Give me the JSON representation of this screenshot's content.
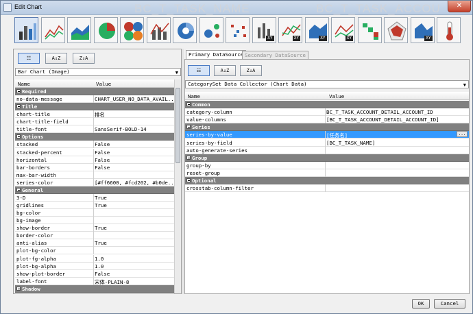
{
  "window": {
    "title": "Edit Chart",
    "close_label": "✕"
  },
  "background_titles": [
    "BC_T_TASK_NAME",
    "BC_T_TASK_ACCOU"
  ],
  "toolbar": {
    "buttons": [
      {
        "name": "bar-chart",
        "xy": ""
      },
      {
        "name": "line-chart",
        "xy": ""
      },
      {
        "name": "area-chart",
        "xy": ""
      },
      {
        "name": "pie-chart",
        "xy": ""
      },
      {
        "name": "multi-pie-chart",
        "xy": ""
      },
      {
        "name": "bar-line-chart",
        "xy": ""
      },
      {
        "name": "ring-chart",
        "xy": ""
      },
      {
        "name": "bubble-chart",
        "xy": ""
      },
      {
        "name": "scatter-chart",
        "xy": ""
      },
      {
        "name": "xy-bar-chart",
        "xy": "XY"
      },
      {
        "name": "xy-line-chart",
        "xy": "XY"
      },
      {
        "name": "xy-area-chart",
        "xy": "XY"
      },
      {
        "name": "xy-line-chart-2",
        "xy": "XY"
      },
      {
        "name": "waterfall-chart",
        "xy": ""
      },
      {
        "name": "radar-chart",
        "xy": ""
      },
      {
        "name": "xy-area-chart-2",
        "xy": "XY"
      },
      {
        "name": "thermometer-chart",
        "xy": ""
      }
    ]
  },
  "left": {
    "sort_buttons": [
      "☷",
      "A↓Z",
      "Z↓A"
    ],
    "combo": "Bar Chart (Image)",
    "col_name": "Name",
    "col_value": "Value",
    "rows": [
      {
        "type": "cat",
        "k": "Required",
        "v": ""
      },
      {
        "type": "row",
        "k": "no-data-message",
        "v": "CHART_USER_NO_DATA_AVAIL..."
      },
      {
        "type": "cat",
        "k": "Title",
        "v": ""
      },
      {
        "type": "row",
        "k": "chart-title",
        "v": "排名"
      },
      {
        "type": "row",
        "k": "chart-title-field",
        "v": ""
      },
      {
        "type": "row",
        "k": "title-font",
        "v": "SansSerif-BOLD-14"
      },
      {
        "type": "cat",
        "k": "Options",
        "v": ""
      },
      {
        "type": "row",
        "k": "stacked",
        "v": "False"
      },
      {
        "type": "row",
        "k": "stacked-percent",
        "v": "False"
      },
      {
        "type": "row",
        "k": "horizontal",
        "v": "False"
      },
      {
        "type": "row",
        "k": "bar-borders",
        "v": "False"
      },
      {
        "type": "row",
        "k": "max-bar-width",
        "v": ""
      },
      {
        "type": "row",
        "k": "series-color",
        "v": "[#ff6600, #fcd202, #b0de..."
      },
      {
        "type": "cat",
        "k": "General",
        "v": ""
      },
      {
        "type": "row",
        "k": "3-D",
        "v": "True"
      },
      {
        "type": "row",
        "k": "gridlines",
        "v": "True"
      },
      {
        "type": "row",
        "k": "bg-color",
        "v": ""
      },
      {
        "type": "row",
        "k": "bg-image",
        "v": ""
      },
      {
        "type": "row",
        "k": "show-border",
        "v": "True"
      },
      {
        "type": "row",
        "k": "border-color",
        "v": ""
      },
      {
        "type": "row",
        "k": "anti-alias",
        "v": "True"
      },
      {
        "type": "row",
        "k": "plot-bg-color",
        "v": ""
      },
      {
        "type": "row",
        "k": "plot-fg-alpha",
        "v": "1.0"
      },
      {
        "type": "row",
        "k": "plot-bg-alpha",
        "v": "1.0"
      },
      {
        "type": "row",
        "k": "show-plot-border",
        "v": "False"
      },
      {
        "type": "row",
        "k": "label-font",
        "v": "宋体-PLAIN-8"
      },
      {
        "type": "cat",
        "k": "Shadow",
        "v": ""
      }
    ]
  },
  "right": {
    "tabs": [
      "Primary DataSource",
      "Secondary DataSource"
    ],
    "sort_buttons": [
      "☷",
      "A↓Z",
      "Z↓A"
    ],
    "combo": "CategorySet Data Collector (Chart Data)",
    "col_name": "Name",
    "col_value": "Value",
    "ellipsis": "...",
    "rows": [
      {
        "type": "cat",
        "k": "Common",
        "v": ""
      },
      {
        "type": "row",
        "k": "category-column",
        "v": "BC_T_TASK_ACCOUNT_DETAIL_ACCOUNT_ID"
      },
      {
        "type": "row",
        "k": "value-columns",
        "v": "[BC_T_TASK_ACCOUNT_DETAIL_ACCOUNT_ID]"
      },
      {
        "type": "cat",
        "k": "Series",
        "v": ""
      },
      {
        "type": "sel",
        "k": "series-by-value",
        "v": "[任务名]"
      },
      {
        "type": "row",
        "k": "series-by-field",
        "v": "[BC_T_TASK_NAME]"
      },
      {
        "type": "row",
        "k": "auto-generate-series",
        "v": ""
      },
      {
        "type": "cat",
        "k": "Group",
        "v": ""
      },
      {
        "type": "row",
        "k": "group-by",
        "v": ""
      },
      {
        "type": "row",
        "k": "reset-group",
        "v": ""
      },
      {
        "type": "cat",
        "k": "Optional",
        "v": ""
      },
      {
        "type": "row",
        "k": "crosstab-column-filter",
        "v": ""
      }
    ]
  },
  "footer": {
    "ok": "OK",
    "cancel": "Cancel"
  }
}
